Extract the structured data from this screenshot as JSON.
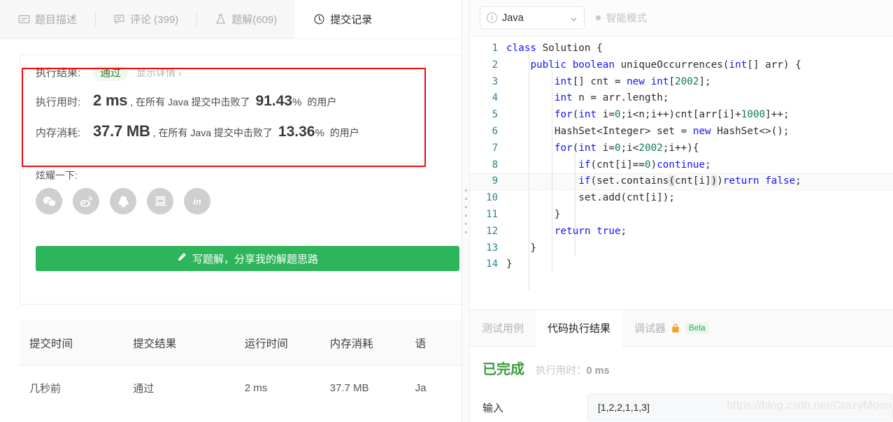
{
  "left": {
    "tabs": [
      {
        "label": "题目描述",
        "icon": "description-icon",
        "active": false
      },
      {
        "label": "评论 (399)",
        "icon": "comment-icon",
        "active": false
      },
      {
        "label": "题解(609)",
        "icon": "flask-icon",
        "active": false
      },
      {
        "label": "提交记录",
        "icon": "clock-icon",
        "active": true
      }
    ],
    "result": {
      "label_result": "执行结果:",
      "status": "通过",
      "detail_link": "显示详情 ›",
      "label_runtime": "执行用时:",
      "runtime_value": "2 ms",
      "runtime_mid": ", 在所有 Java 提交中击败了",
      "runtime_pct": "91.43",
      "pct_symbol": "%",
      "tail": "的用户",
      "label_memory": "内存消耗:",
      "memory_value": "37.7 MB",
      "memory_mid": ", 在所有 Java 提交中击败了",
      "memory_pct": "13.36"
    },
    "share": {
      "label": "炫耀一下:",
      "buttons": [
        {
          "name": "wechat-icon",
          "glyph": "wechat"
        },
        {
          "name": "weibo-icon",
          "glyph": "weibo"
        },
        {
          "name": "qq-icon",
          "glyph": "qq"
        },
        {
          "name": "douban-icon",
          "glyph": "douban"
        },
        {
          "name": "linkedin-icon",
          "glyph": "in"
        }
      ]
    },
    "write_button": "写题解，分享我的解题思路",
    "table": {
      "headers": [
        "提交时间",
        "提交结果",
        "运行时间",
        "内存消耗",
        "语"
      ],
      "rows": [
        {
          "time": "几秒前",
          "result": "通过",
          "runtime": "2 ms",
          "memory": "37.7 MB",
          "lang": "Ja"
        }
      ]
    }
  },
  "right": {
    "language": "Java",
    "smart_mode": "智能模式",
    "code_lines": [
      {
        "n": "1",
        "html": "<span class=\"k\">class</span> Solution {"
      },
      {
        "n": "2",
        "html": "    <span class=\"k\">public</span> <span class=\"k\">boolean</span> uniqueOccurrences(<span class=\"k\">int</span>[] arr) {"
      },
      {
        "n": "3",
        "html": "        <span class=\"k\">int</span>[] cnt = <span class=\"k\">new</span> <span class=\"k\">int</span>[<span class=\"n\">2002</span>];"
      },
      {
        "n": "4",
        "html": "        <span class=\"k\">int</span> n = arr.length;"
      },
      {
        "n": "5",
        "html": "        <span class=\"k\">for</span>(<span class=\"k\">int</span> i=<span class=\"n\">0</span>;i&lt;n;i++)cnt[arr[i]+<span class=\"n\">1000</span>]++;"
      },
      {
        "n": "6",
        "html": "        HashSet&lt;Integer&gt; set = <span class=\"k\">new</span> HashSet&lt;&gt;();"
      },
      {
        "n": "7",
        "html": "        <span class=\"k\">for</span>(<span class=\"k\">int</span> i=<span class=\"n\">0</span>;i&lt;<span class=\"n\">2002</span>;i++){"
      },
      {
        "n": "8",
        "html": "            <span class=\"k\">if</span>(cnt[i]==<span class=\"n\">0</span>)<span class=\"k\">continue</span>;"
      },
      {
        "n": "9",
        "html": "            <span class=\"k\">if</span>(set.contains<span class=\"hl\">(</span>cnt[i]<span class=\"hl\">)</span>)<span class=\"k\">return</span> <span class=\"k\">false</span>;",
        "active": true
      },
      {
        "n": "10",
        "html": "            set.add(cnt[i]);"
      },
      {
        "n": "11",
        "html": "        }"
      },
      {
        "n": "12",
        "html": "        <span class=\"k\">return</span> <span class=\"k\">true</span>;"
      },
      {
        "n": "13",
        "html": "    }"
      },
      {
        "n": "14",
        "html": "}"
      }
    ],
    "console_tabs": [
      {
        "label": "测试用例",
        "active": false
      },
      {
        "label": "代码执行结果",
        "active": true
      },
      {
        "label": "调试器",
        "active": false,
        "badge": "Beta",
        "icon": "lock-icon"
      }
    ],
    "console": {
      "status": "已完成",
      "runtime_label": "执行用时：",
      "runtime_value": "0 ms",
      "input_label": "输入",
      "input_value": "[1,2,2,1,1,3]"
    },
    "watermark": "https://blog.csdn.net/CrazyMooo"
  }
}
